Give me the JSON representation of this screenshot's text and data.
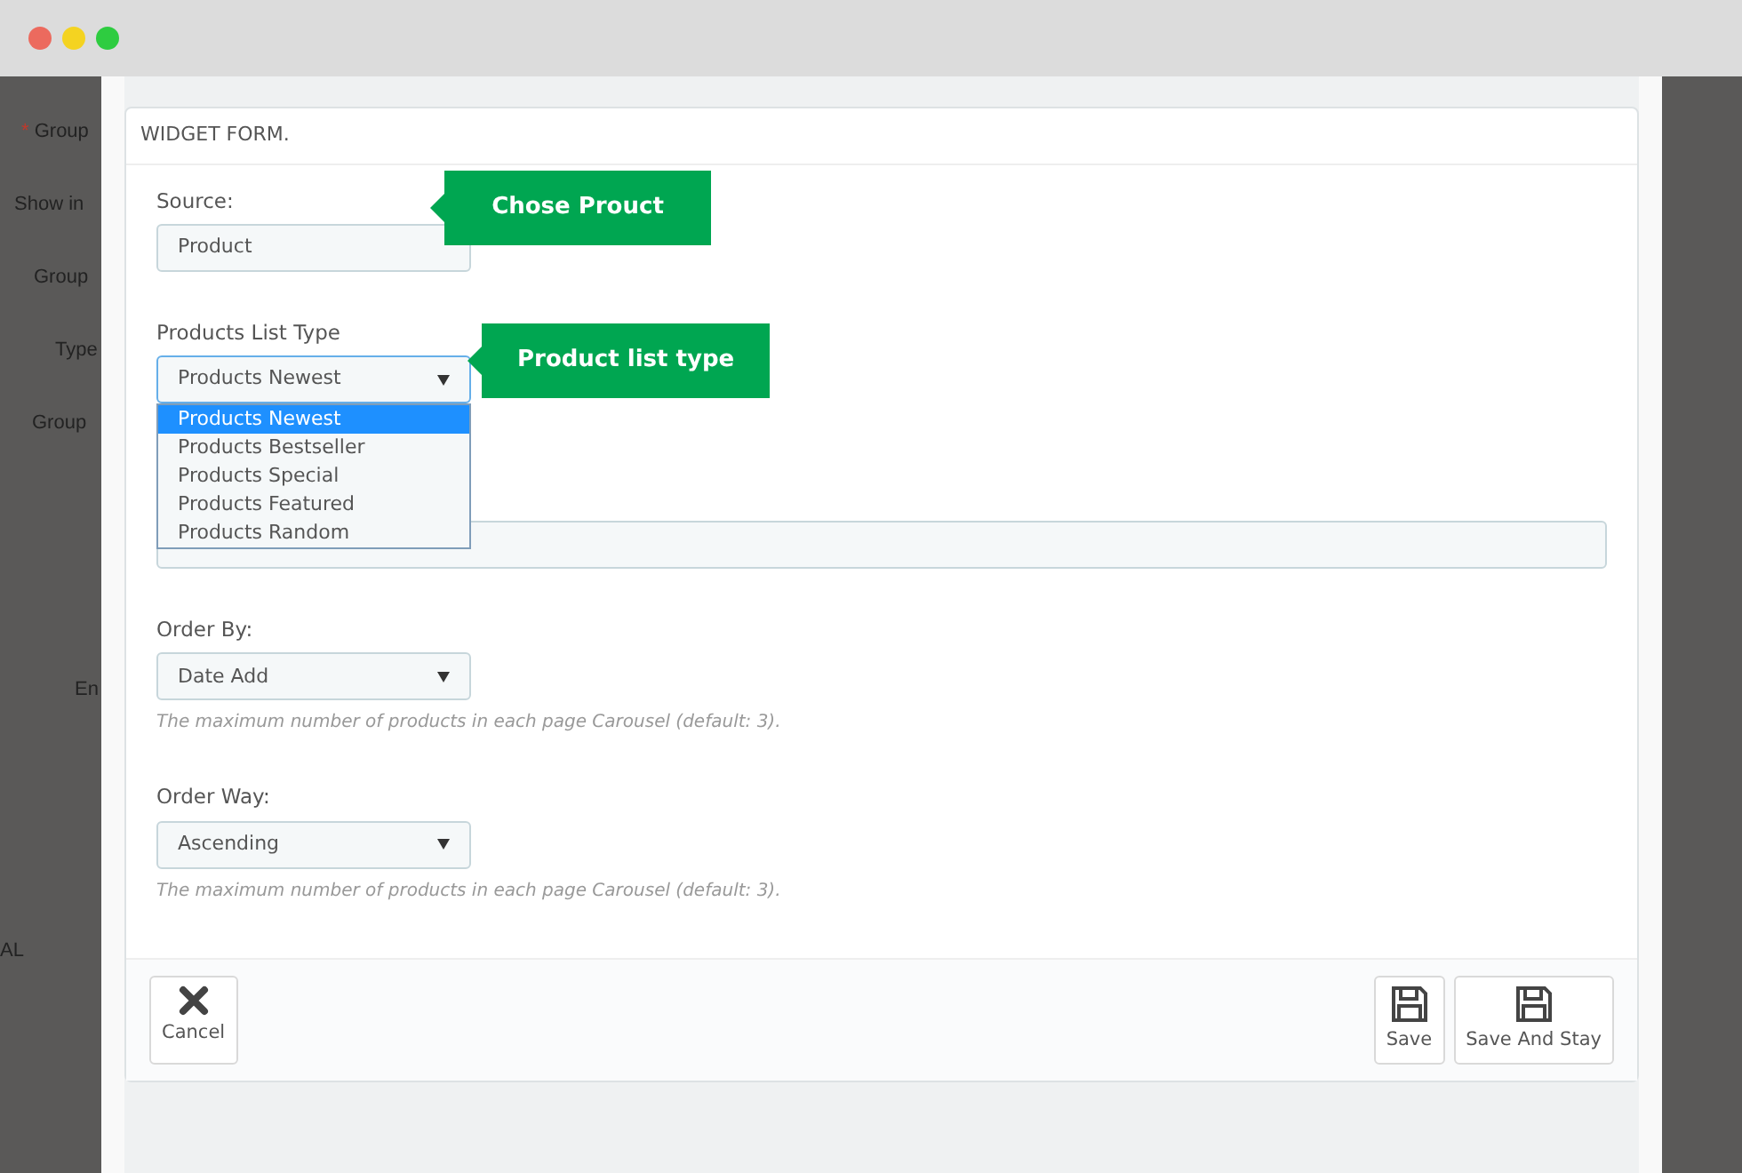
{
  "window": {
    "buttons": [
      {
        "color": "#ec6a5e"
      },
      {
        "color": "#f4d321"
      },
      {
        "color": "#2ecc40"
      }
    ]
  },
  "background_form": {
    "labels": [
      {
        "text": "Group",
        "marker": "*"
      },
      {
        "text": "Show in"
      },
      {
        "text": "Group"
      },
      {
        "text": "Type"
      },
      {
        "text": "Group"
      },
      {
        "text": "En"
      },
      {
        "text": "AL"
      }
    ]
  },
  "panel": {
    "title": "WIDGET FORM.",
    "fields": [
      {
        "kind": "input",
        "label": "Source:",
        "value": "Product",
        "callout": "Chose Prouct"
      },
      {
        "kind": "select",
        "label": "Products List Type",
        "value": "Products Newest",
        "focused": true,
        "callout": "Product list type",
        "options": [
          {
            "label": "Products Newest",
            "selected": true
          },
          {
            "label": "Products Bestseller",
            "selected": false
          },
          {
            "label": "Products Special",
            "selected": false
          },
          {
            "label": "Products Featured",
            "selected": false
          },
          {
            "label": "Products Random",
            "selected": false
          }
        ]
      },
      {
        "kind": "textbox"
      },
      {
        "kind": "select",
        "label": "Order By:",
        "value": "Date Add",
        "focused": false,
        "help": "The maximum number of products in each page Carousel (default: 3)."
      },
      {
        "kind": "select",
        "label": "Order Way:",
        "value": "Ascending",
        "focused": false,
        "help": "The maximum number of products in each page Carousel (default: 3)."
      }
    ],
    "buttons": [
      {
        "label": "Cancel",
        "kind": "cancel"
      },
      {
        "label": "Save",
        "kind": "save"
      },
      {
        "label": "Save And Stay",
        "kind": "save"
      }
    ]
  }
}
